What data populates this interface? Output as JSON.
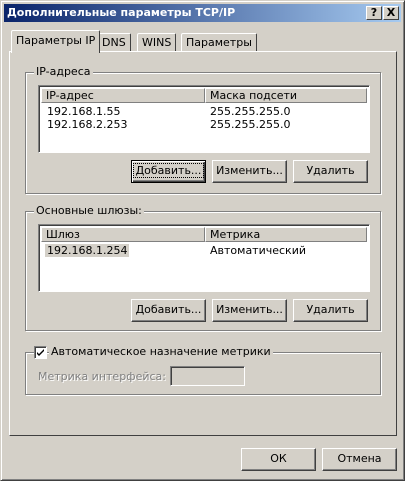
{
  "window": {
    "title": "Дополнительные параметры TCP/IP",
    "help_label": "?",
    "close_label": "X"
  },
  "tabs": [
    "Параметры IP",
    "DNS",
    "WINS",
    "Параметры"
  ],
  "ip_group": {
    "label": "IP-адреса",
    "columns": [
      "IP-адрес",
      "Маска подсети"
    ],
    "rows": [
      [
        "192.168.1.55",
        "255.255.255.0"
      ],
      [
        "192.168.2.253",
        "255.255.255.0"
      ]
    ],
    "buttons": {
      "add": "Добавить...",
      "edit": "Изменить...",
      "delete": "Удалить"
    }
  },
  "gateway_group": {
    "label": "Основные шлюзы:",
    "columns": [
      "Шлюз",
      "Метрика"
    ],
    "rows": [
      [
        "192.168.1.254",
        "Автоматический"
      ]
    ],
    "buttons": {
      "add": "Добавить...",
      "edit": "Изменить...",
      "delete": "Удалить"
    }
  },
  "metric_group": {
    "checkbox_label": "Автоматическое назначение метрики",
    "checked": true,
    "interface_metric_label": "Метрика интерфейса:",
    "interface_metric_value": ""
  },
  "footer": {
    "ok": "ОК",
    "cancel": "Отмена"
  }
}
